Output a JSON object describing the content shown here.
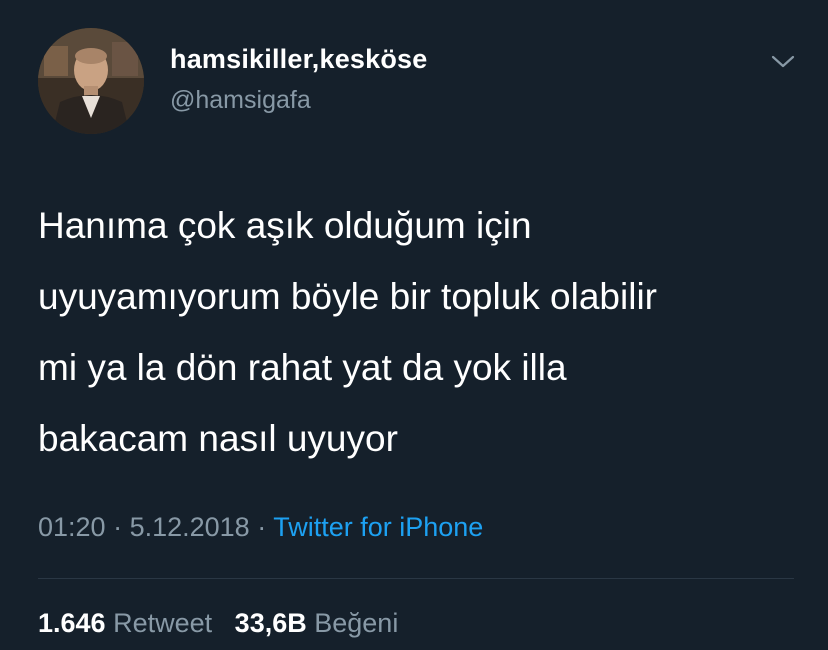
{
  "user": {
    "display_name": "hamsikiller,kesköse",
    "handle": "@hamsigafa",
    "avatar_icon": "user-avatar-photo"
  },
  "tweet": {
    "text": "Hanıma çok aşık olduğum için\nuyuyamıyorum böyle bir topluk olabilir\nmi ya la dön rahat yat da yok illa\nbakacam nasıl uyuyor"
  },
  "meta": {
    "time": "01:20",
    "separator1": " · ",
    "date": "5.12.2018",
    "separator2": " · ",
    "source": "Twitter for iPhone"
  },
  "stats": {
    "retweets_count": "1.646",
    "retweets_label": "Retweet",
    "likes_count": "33,6B",
    "likes_label": "Beğeni"
  },
  "colors": {
    "background": "#15202b",
    "secondary_text": "#8899a6",
    "link": "#1da1f2",
    "primary_text": "#ffffff"
  },
  "icons": {
    "more_menu": "chevron-down-icon"
  }
}
